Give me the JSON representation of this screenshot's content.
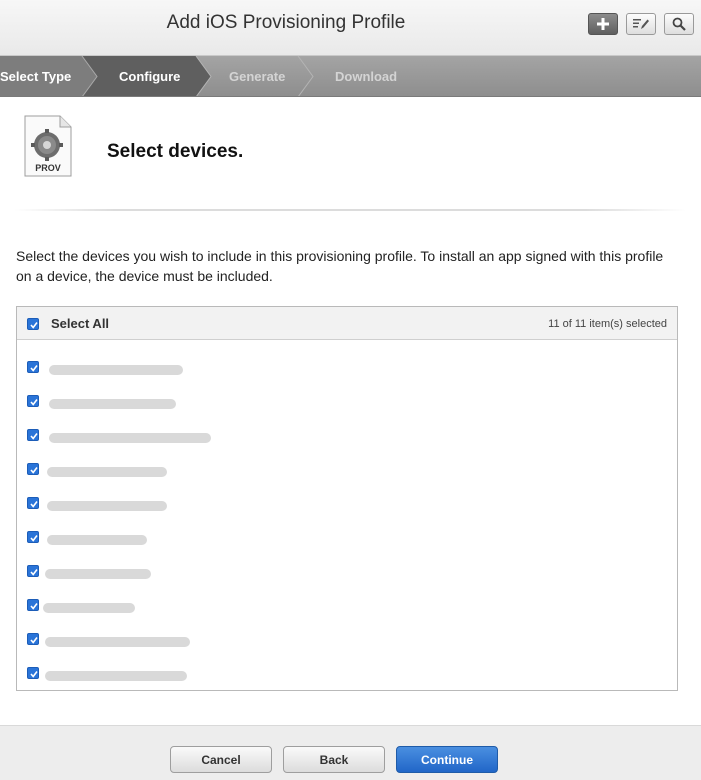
{
  "header": {
    "title": "Add iOS Provisioning Profile",
    "tools": [
      {
        "icon": "plus-icon",
        "active": true
      },
      {
        "icon": "edit-icon",
        "active": false
      },
      {
        "icon": "search-icon",
        "active": false
      }
    ]
  },
  "steps": [
    {
      "label": "Select Type",
      "state": "done"
    },
    {
      "label": "Configure",
      "state": "current"
    },
    {
      "label": "Generate",
      "state": "future"
    },
    {
      "label": "Download",
      "state": "future"
    }
  ],
  "page": {
    "icon_label": "PROV",
    "heading": "Select devices.",
    "description": "Select the devices you wish to include in this provisioning profile. To install an app signed with this profile on a device, the device must be included."
  },
  "device_list": {
    "select_all_label": "Select All",
    "select_all_checked": true,
    "count_label": "11 of 11 item(s) selected",
    "devices": [
      {
        "name": "",
        "checked": true
      },
      {
        "name": "",
        "checked": true
      },
      {
        "name": "",
        "checked": true
      },
      {
        "name": "",
        "checked": true
      },
      {
        "name": "",
        "checked": true
      },
      {
        "name": "",
        "checked": true
      },
      {
        "name": "",
        "checked": true
      },
      {
        "name": "",
        "checked": true
      },
      {
        "name": "",
        "checked": true
      },
      {
        "name": "",
        "checked": true
      }
    ]
  },
  "footer": {
    "cancel_label": "Cancel",
    "back_label": "Back",
    "continue_label": "Continue"
  },
  "colors": {
    "accent": "#2a74d8",
    "primary_button": "#2166c8",
    "step_bar": "#9a9a9a",
    "step_active": "#6f6f6f"
  }
}
